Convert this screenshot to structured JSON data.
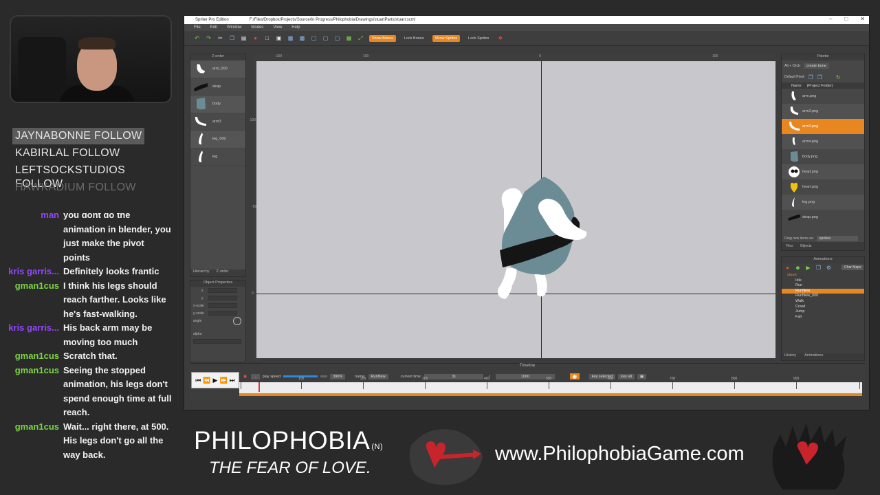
{
  "followers": [
    {
      "name": "JAYNABONNE",
      "action": "FOLLOW",
      "style": "highlight"
    },
    {
      "name": "KABIRLAL",
      "action": "FOLLOW",
      "style": "normal"
    },
    {
      "name": "LEFTSOCKSTUDIOS",
      "action": "FOLLOW",
      "style": "normal"
    },
    {
      "name": "HAWKADIUM",
      "action": "FOLLOW",
      "style": "faded"
    }
  ],
  "chat": [
    {
      "user": "man",
      "color": "purple",
      "message": "you dont do the animation in blender, you just make the pivot points"
    },
    {
      "user": "kris garris...",
      "color": "purple",
      "message": "Definitely looks frantic"
    },
    {
      "user": "gman1cus",
      "color": "green",
      "message": "I think his legs should reach farther. Looks like he's fast-walking."
    },
    {
      "user": "kris garris...",
      "color": "purple",
      "message": "His back arm may be moving too much"
    },
    {
      "user": "gman1cus",
      "color": "green",
      "message": "Scratch that."
    },
    {
      "user": "gman1cus",
      "color": "green",
      "message": "Seeing the stopped animation, his legs don't spend enough time at full reach."
    },
    {
      "user": "gman1cus",
      "color": "green",
      "message": "Wait... right there, at 500. His legs don't go all the way back."
    }
  ],
  "window": {
    "app_title": "Spriter Pro Edition",
    "file_path": "F:/Files/Dropbox/Projects/Source/In Progress/Philophobia/Drawings/stuartParts/stuart.scml",
    "menu": [
      "File",
      "Edit",
      "Window",
      "Modes",
      "View",
      "Help"
    ],
    "toolbar_buttons": [
      {
        "label": "Show Bones",
        "on": true
      },
      {
        "label": "Lock Bones",
        "on": false
      },
      {
        "label": "Show Sprites",
        "on": true
      },
      {
        "label": "Lock Sprites",
        "on": false
      }
    ]
  },
  "zorder": {
    "title": "Z-order",
    "items": [
      "arm_000",
      "strap",
      "body",
      "arm3",
      "leg_000",
      "leg"
    ],
    "tabs": [
      "Hierarchy",
      "Z-order"
    ]
  },
  "object_properties": {
    "title": "Object Properties",
    "fields": [
      "x",
      "y",
      "x-scale",
      "y-scale",
      "angle",
      "alpha"
    ]
  },
  "rulers": {
    "top": [
      "-100",
      "100",
      "0",
      "100"
    ],
    "left": [
      "-100",
      "-50",
      "0"
    ]
  },
  "palette": {
    "title": "Palette",
    "alt_click": "Alt + Click:",
    "alt_click_value": "create bone",
    "default_pivot": "Default Pivot:",
    "col_name": "Name",
    "col_folder": "(Project Folder)",
    "files": [
      "arm.png",
      "arm2.png",
      "arm3.png",
      "arm4.png",
      "body.png",
      "head.png",
      "heart.png",
      "leg.png",
      "strap.png"
    ],
    "selected_file": "arm3.png",
    "drag_label": "Drag new items as:",
    "drag_value": "sprites",
    "tabs": [
      "Files",
      "Objects"
    ]
  },
  "animations": {
    "title": "Animations",
    "char_maps": "Char Maps",
    "entity": "stuart",
    "items": [
      "Idle",
      "Run",
      "RunNew",
      "RunNew_000",
      "Walk",
      "Crawl",
      "Jump",
      "Fall"
    ],
    "selected": "RunNew",
    "tabs": [
      "History",
      "Animations"
    ]
  },
  "timeline": {
    "title": "Timeline",
    "play_speed_label": "play speed",
    "play_speed_value": "396%",
    "name_label": "name:",
    "name_value": "RunNew",
    "current_time_label": "current time:",
    "current_time_value": "31",
    "separator": "/",
    "length_value": "1000",
    "key_selected": "key selected",
    "key_all": "key all",
    "ticks": [
      "100",
      "200",
      "300",
      "400",
      "500",
      "600",
      "700",
      "800",
      "900"
    ]
  },
  "banner": {
    "title": "PHILOPHOBIA",
    "title_suffix": "(N)",
    "subtitle": "THE FEAR OF LOVE.",
    "url": "www.PhilophobiaGame.com"
  },
  "colors": {
    "accent_orange": "#e8861f",
    "chat_purple": "#9146ff",
    "chat_green": "#7bd442",
    "canvas_bg": "#c8c7cc",
    "body_gray": "#6b8c95",
    "logo_red": "#c8242b"
  }
}
